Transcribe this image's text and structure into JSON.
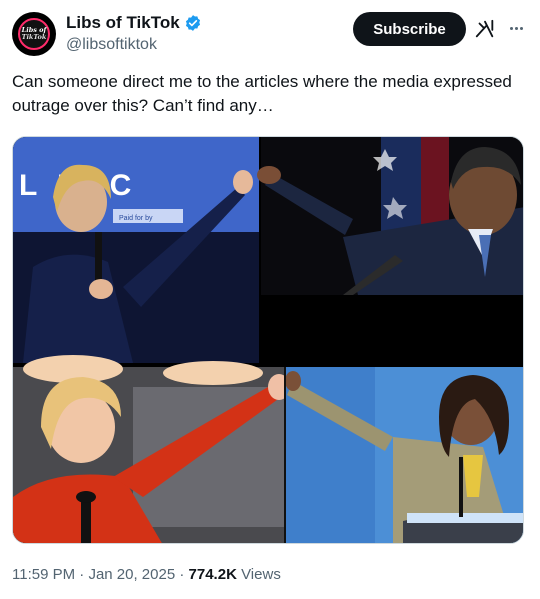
{
  "author": {
    "display_name": "Libs of TikTok",
    "handle": "@libsoftiktok",
    "avatar_text_line1": "Libs of",
    "avatar_text_line2": "TikTok",
    "verified": true
  },
  "actions": {
    "subscribe_label": "Subscribe",
    "grok_icon": "grok-icon",
    "more_icon": "more-icon"
  },
  "tweet": {
    "text": "Can someone direct me to the articles where the media expressed outrage over this? Can’t find any…"
  },
  "media": {
    "description_icons": [
      "photo-collage"
    ],
    "sign_text": "L  RYC",
    "sign_subtext": "Paid for by"
  },
  "meta": {
    "time": "11:59 PM",
    "date": "Jan 20, 2025",
    "views_count": "774.2K",
    "views_label": "Views",
    "separator": "·"
  },
  "colors": {
    "accent_verified": "#1d9bf0",
    "text_primary": "#0f1419",
    "text_secondary": "#536471",
    "subscribe_bg": "#0f1419"
  }
}
